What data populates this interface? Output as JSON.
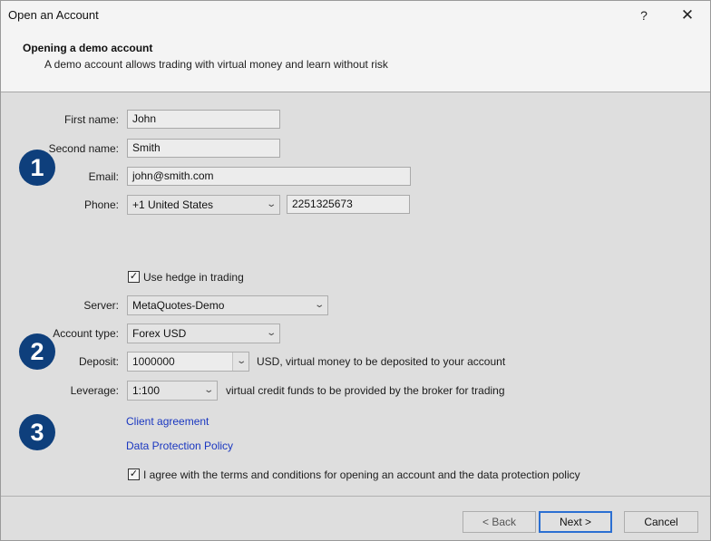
{
  "window": {
    "title": "Open an Account",
    "help_label": "?",
    "close_label": "✕"
  },
  "header": {
    "title": "Opening a demo account",
    "subtitle": "A demo account allows trading with virtual money and learn without risk"
  },
  "personal": {
    "first_name": {
      "label": "First name:",
      "value": "John"
    },
    "second_name": {
      "label": "Second name:",
      "value": "Smith"
    },
    "email": {
      "label": "Email:",
      "value": "john@smith.com"
    },
    "phone": {
      "label": "Phone:",
      "country": "+1 United States",
      "number": "2251325673"
    }
  },
  "trading": {
    "hedge": {
      "label": "Use hedge in trading",
      "checked": true
    },
    "server": {
      "label": "Server:",
      "value": "MetaQuotes-Demo"
    },
    "account_type": {
      "label": "Account type:",
      "value": "Forex USD"
    },
    "deposit": {
      "label": "Deposit:",
      "value": "1000000",
      "description": "USD, virtual money to be deposited to your account"
    },
    "leverage": {
      "label": "Leverage:",
      "value": "1:100",
      "description": "virtual credit funds to be provided by the broker for trading"
    }
  },
  "agreement": {
    "client_agreement": "Client agreement",
    "data_protection": "Data Protection Policy",
    "agree": {
      "label": "I agree with the terms and conditions for opening an account and the data protection policy",
      "checked": true
    }
  },
  "badges": [
    "1",
    "2",
    "3"
  ],
  "buttons": {
    "back": "< Back",
    "next": "Next >",
    "cancel": "Cancel"
  },
  "colors": {
    "badge": "#0e3f7c",
    "link": "#1a37c0",
    "focus_border": "#2b6fd2"
  }
}
